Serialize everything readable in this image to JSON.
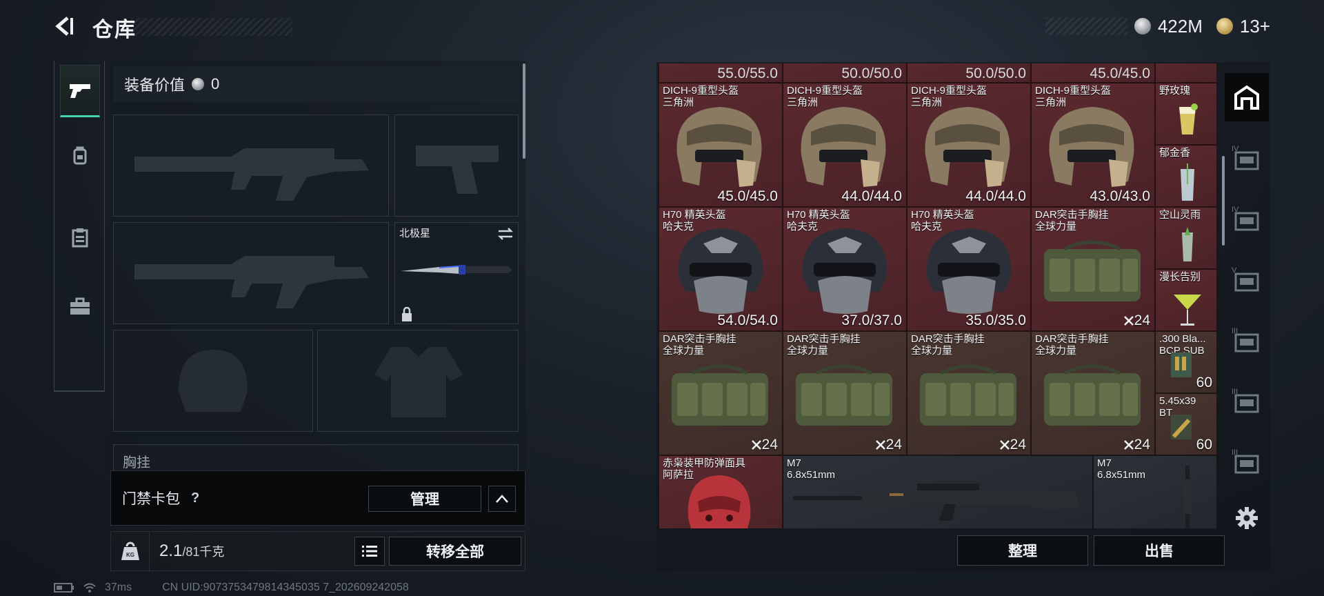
{
  "header": {
    "title": "仓库",
    "currency_silver": "422M",
    "currency_gold": "13+"
  },
  "left_nav": {
    "items": [
      "gun-icon",
      "backpack-icon",
      "clipboard-icon",
      "toolbox-icon"
    ]
  },
  "equipment": {
    "value_label": "装备价值",
    "value": "0",
    "melee_name": "北极星",
    "chest_label": "胸挂"
  },
  "access_card": {
    "label": "门禁卡包",
    "help": "?",
    "manage_label": "管理"
  },
  "weight": {
    "current": "2.1",
    "max": "/81千克"
  },
  "transfer_all_label": "转移全部",
  "status": {
    "ping": "37ms",
    "uid": "CN UID:9073753479814345035 7_202609242058"
  },
  "inventory": {
    "top_row": [
      "55.0/55.0",
      "50.0/50.0",
      "50.0/50.0",
      "45.0/45.0"
    ],
    "rows": [
      [
        {
          "name": "DICH-9重型头盔",
          "sub": "三角洲",
          "value": "45.0/45.0"
        },
        {
          "name": "DICH-9重型头盔",
          "sub": "三角洲",
          "value": "44.0/44.0"
        },
        {
          "name": "DICH-9重型头盔",
          "sub": "三角洲",
          "value": "44.0/44.0"
        },
        {
          "name": "DICH-9重型头盔",
          "sub": "三角洲",
          "value": "43.0/43.0"
        }
      ],
      [
        {
          "name": "H70 精英头盔",
          "sub": "哈夫克",
          "value": "54.0/54.0"
        },
        {
          "name": "H70 精英头盔",
          "sub": "哈夫克",
          "value": "37.0/37.0"
        },
        {
          "name": "H70 精英头盔",
          "sub": "哈夫克",
          "value": "35.0/35.0"
        },
        {
          "name": "DAR突击手胸挂",
          "sub": "全球力量",
          "value": "24"
        }
      ],
      [
        {
          "name": "DAR突击手胸挂",
          "sub": "全球力量",
          "value": "24"
        },
        {
          "name": "DAR突击手胸挂",
          "sub": "全球力量",
          "value": "24"
        },
        {
          "name": "DAR突击手胸挂",
          "sub": "全球力量",
          "value": "24"
        },
        {
          "name": "DAR突击手胸挂",
          "sub": "全球力量",
          "value": "24"
        }
      ]
    ],
    "side_items": [
      {
        "name": "野玫瑰"
      },
      {
        "name": "郁金香"
      },
      {
        "name": "空山灵雨"
      },
      {
        "name": "漫长告别"
      },
      {
        "name": ".300 Bla...",
        "sub": "BCP SUB",
        "qty": "60"
      },
      {
        "name": "5.45x39",
        "sub": "BT",
        "qty": "60"
      }
    ],
    "bottom_row": {
      "mask": {
        "name": "赤枭装甲防弹面具",
        "sub": "阿萨拉"
      },
      "m7_a": {
        "name": "M7",
        "sub": "6.8x51mm"
      },
      "m7_b": {
        "name": "M7",
        "sub": "6.8x51mm"
      }
    }
  },
  "buttons": {
    "sort": "整理",
    "sell": "出售"
  },
  "right_nav": {
    "items": [
      "house-icon",
      "shelf-icon",
      "shelf-icon",
      "shelf-icon",
      "shelf-icon",
      "shelf-icon",
      "shelf-icon",
      "gear-icon"
    ],
    "tier_labels": [
      "IV",
      "IV",
      "V",
      "III",
      "III",
      "III"
    ]
  },
  "colors": {
    "accent": "#42d6b0",
    "cell_red": "#5b2a30",
    "cell_brown": "#4a3530"
  }
}
